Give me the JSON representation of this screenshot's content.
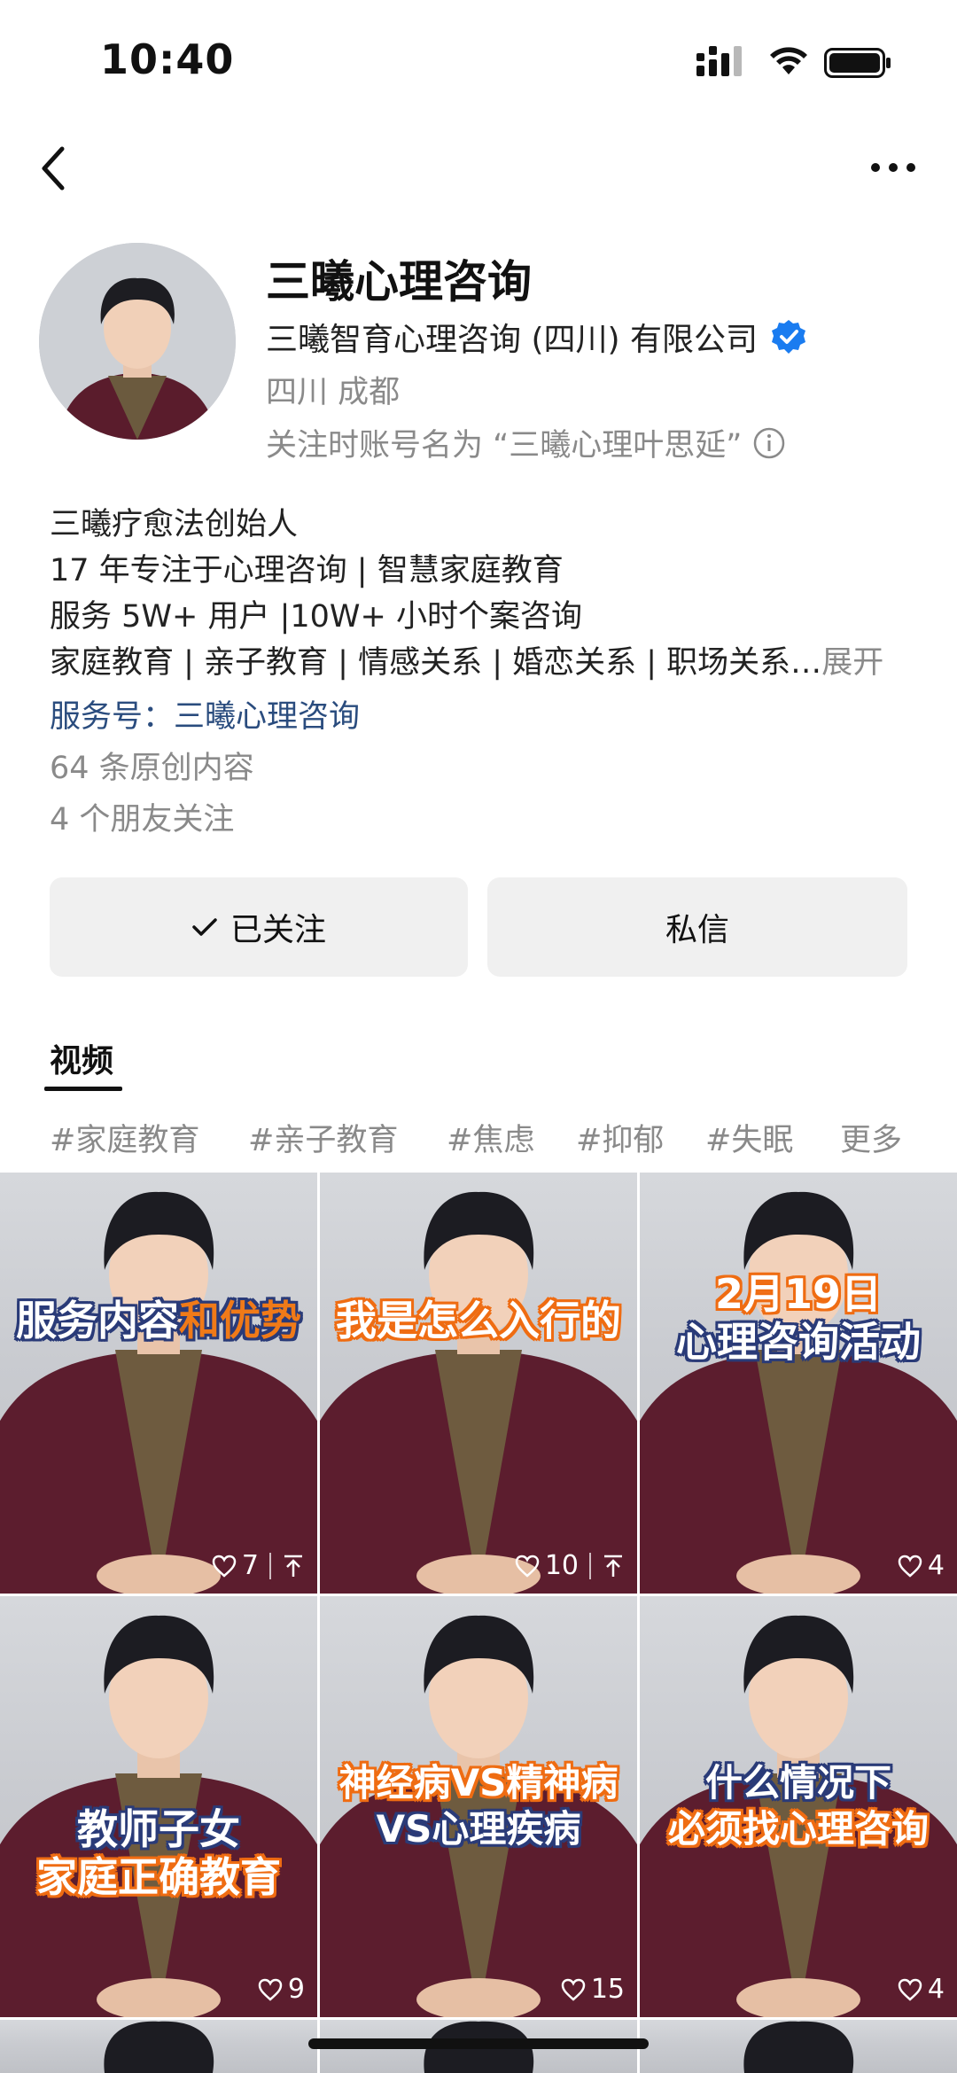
{
  "status_bar": {
    "time": "10:40"
  },
  "profile": {
    "name": "三曦心理咨询",
    "company": "三曦智育心理咨询 (四川) 有限公司",
    "location": "四川 成都",
    "follow_name_note": "关注时账号名为 “三曦心理叶思延”"
  },
  "bio": {
    "lines": [
      "三曦疗愈法创始人",
      "17 年专注于心理咨询 | 智慧家庭教育",
      "服务 5W+ 用户 |10W+ 小时个案咨询",
      "家庭教育 | 亲子教育 | 情感关系 | 婚恋关系 | 职场关系…"
    ],
    "expand_label": "展开",
    "service_account": "服务号：三曦心理咨询",
    "original_count": "64 条原创内容",
    "friends_follow": "4 个朋友关注"
  },
  "actions": {
    "follow_label": "已关注",
    "message_label": "私信"
  },
  "tabs": {
    "video_label": "视频"
  },
  "tags": [
    "#家庭教育",
    "#亲子教育",
    "#焦虑",
    "#抑郁",
    "#失眠",
    "更多"
  ],
  "videos": [
    {
      "caption_1": "服务内容",
      "caption_1b": "和优势",
      "likes": "7",
      "pinned": true
    },
    {
      "caption_1": "我是怎么入行的",
      "likes": "10",
      "pinned": true
    },
    {
      "caption_1": "2月19日",
      "caption_2": "心理咨询活动",
      "likes": "4",
      "pinned": false
    },
    {
      "caption_1": "教师子女",
      "caption_2": "家庭正确教育",
      "likes": "9",
      "pinned": false
    },
    {
      "caption_1": "神经病VS精神病",
      "caption_2": "VS心理疾病",
      "likes": "15",
      "pinned": false
    },
    {
      "caption_1": "什么情况下",
      "caption_2": "必须找心理咨询",
      "likes": "4",
      "pinned": false
    }
  ],
  "colors": {
    "link_blue": "#2a4c7e",
    "verify_blue": "#1a7cf0",
    "caption_navy": "#2a3b78",
    "caption_orange": "#ef6c12"
  }
}
